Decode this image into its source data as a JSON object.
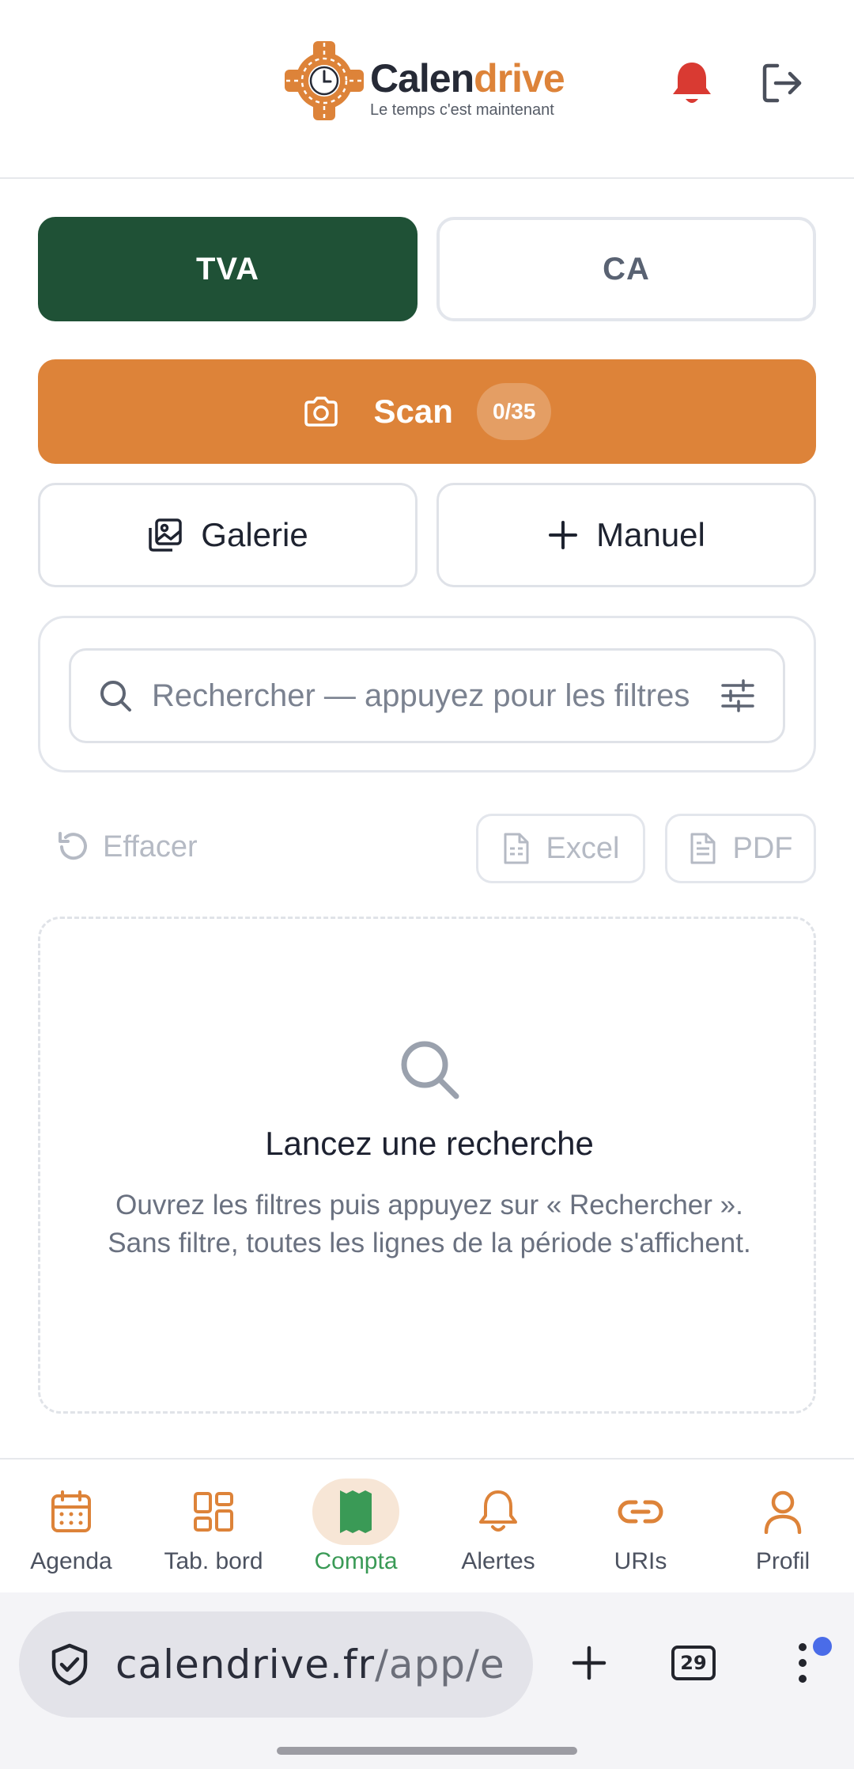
{
  "header": {
    "logo_text_main": "Calen",
    "logo_text_accent": "drive",
    "tagline": "Le temps c'est maintenant",
    "icons": [
      "bell-icon",
      "logout-icon"
    ]
  },
  "toggle": {
    "tva_label": "TVA",
    "ca_label": "CA",
    "active": "TVA"
  },
  "scan": {
    "label": "Scan",
    "badge": "0/35",
    "icon": "camera-icon"
  },
  "actions": {
    "gallery_label": "Galerie",
    "manual_label": "Manuel"
  },
  "search": {
    "placeholder": "Rechercher — appuyez pour les filtres"
  },
  "toolbar": {
    "clear_label": "Effacer",
    "excel_label": "Excel",
    "pdf_label": "PDF"
  },
  "empty_state": {
    "title": "Lancez une recherche",
    "text": "Ouvrez les filtres puis appuyez sur « Rechercher ». Sans filtre, toutes les lignes de la période s'affichent."
  },
  "bottom_nav": {
    "items": [
      {
        "label": "Agenda",
        "icon": "calendar-icon"
      },
      {
        "label": "Tab. bord",
        "icon": "dashboard-icon"
      },
      {
        "label": "Compta",
        "icon": "receipt-icon",
        "active": true
      },
      {
        "label": "Alertes",
        "icon": "bell-icon"
      },
      {
        "label": "URIs",
        "icon": "link-icon"
      },
      {
        "label": "Profil",
        "icon": "user-icon"
      }
    ]
  },
  "browser": {
    "url_host": "calendrive.fr",
    "url_path": "/app/e",
    "tab_count": "29"
  },
  "colors": {
    "primary_green": "#1f5136",
    "accent_orange": "#dd8339",
    "active_nav_green": "#3a9a56",
    "alert_red": "#d93a32"
  }
}
